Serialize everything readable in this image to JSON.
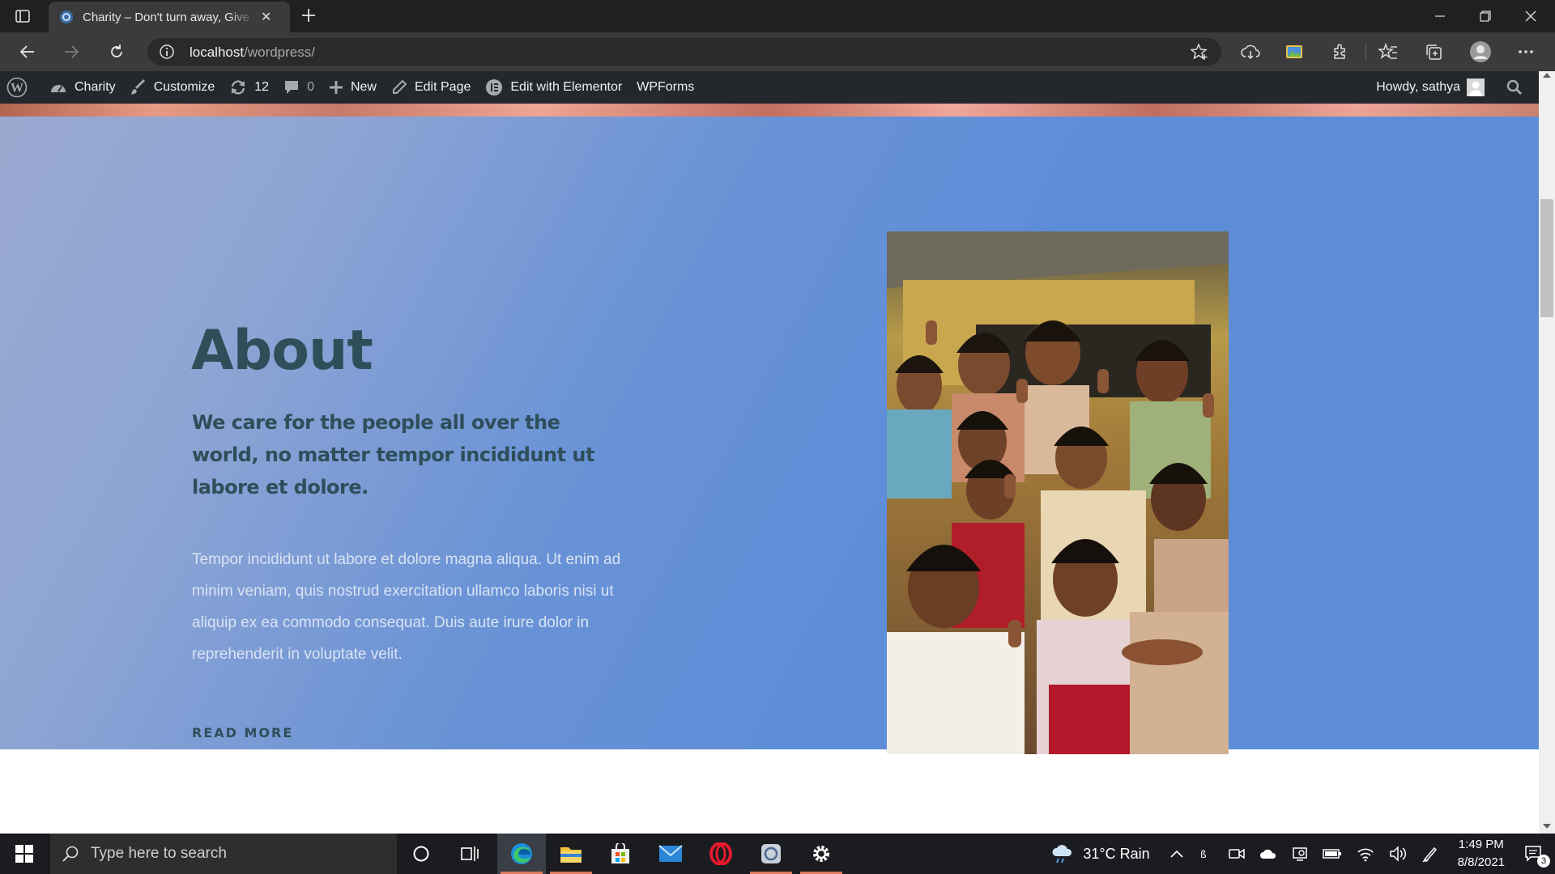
{
  "browser": {
    "tab_title": "Charity – Don't turn away, Give to the world",
    "url_host": "localhost",
    "url_path": "/wordpress/"
  },
  "wp_admin_bar": {
    "site_name": "Charity",
    "customize": "Customize",
    "updates_count": "12",
    "comments_count": "0",
    "new": "New",
    "edit_page": "Edit Page",
    "edit_elementor": "Edit with Elementor",
    "wpforms": "WPForms",
    "howdy": "Howdy, sathya"
  },
  "about": {
    "title": "About",
    "subtitle": "We care for the people all over the world, no matter tempor incididunt ut labore et dolore.",
    "body": "Tempor incididunt ut labore et dolore magna aliqua. Ut enim ad minim veniam, quis nostrud exercitation ullamco laboris nisi ut aliquip ex ea commodo consequat. Duis aute irure dolor in reprehenderit in voluptate velit.",
    "read_more": "READ MORE"
  },
  "taskbar": {
    "search_placeholder": "Type here to search",
    "weather": "31°C  Rain",
    "time": "1:49 PM",
    "date": "8/8/2021",
    "notification_count": "3"
  },
  "colors": {
    "about_bg": "#5e8dd8",
    "heading": "#2e4e5a",
    "admin_bar": "#23282d",
    "taskbar": "#1a1c20"
  }
}
